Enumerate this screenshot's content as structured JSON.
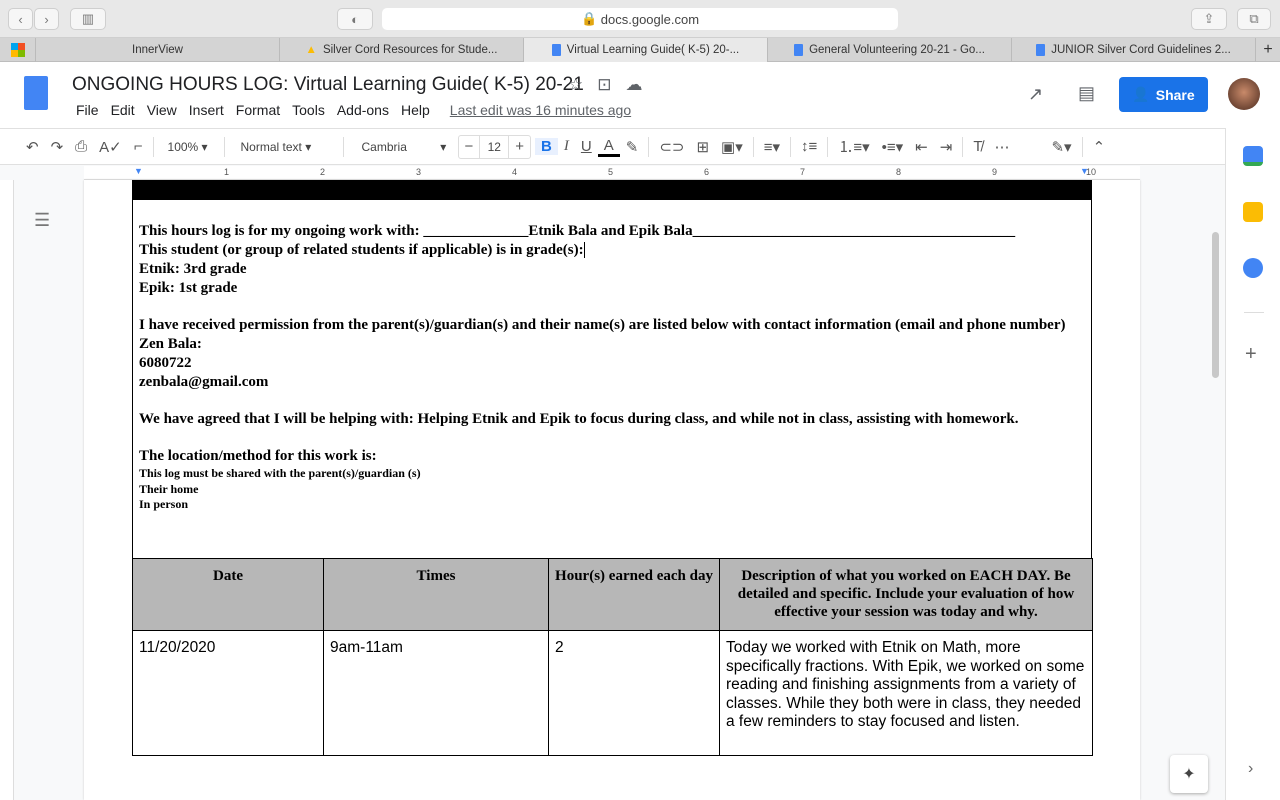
{
  "browser": {
    "url": "docs.google.com",
    "tabs": [
      {
        "label": "InnerView"
      },
      {
        "label": "Silver Cord Resources for Stude..."
      },
      {
        "label": "Virtual Learning Guide( K-5) 20-...",
        "active": true
      },
      {
        "label": "General Volunteering 20-21 - Go..."
      },
      {
        "label": "JUNIOR Silver Cord Guidelines 2..."
      }
    ]
  },
  "doc": {
    "title": "ONGOING HOURS LOG: Virtual Learning Guide( K-5) 20-21",
    "menu": [
      "File",
      "Edit",
      "View",
      "Insert",
      "Format",
      "Tools",
      "Add-ons",
      "Help"
    ],
    "last_edit": "Last edit was 16 minutes ago",
    "share": "Share"
  },
  "toolbar": {
    "zoom": "100%",
    "style": "Normal text",
    "font": "Cambria",
    "size": "12"
  },
  "ruler": [
    "1",
    "2",
    "3",
    "4",
    "5",
    "6",
    "7",
    "8",
    "9",
    "10"
  ],
  "body": {
    "l1": "This hours log is for my ongoing work with: ______________Etnik Bala and Epik Bala___________________________________________",
    "l2": "This student (or group of related students if applicable) is in grade(s):",
    "l3": "Etnik: 3rd grade",
    "l4": "Epik: 1st grade",
    "l5": "I have received permission from the parent(s)/guardian(s) and their name(s) are listed below with contact information (email and phone number)",
    "l6": "Zen Bala:",
    "l7": "6080722",
    "l8": "zenbala@gmail.com",
    "l9": "We have agreed that I will be helping with: Helping Etnik and Epik to focus during class, and while not in class, assisting with homework.",
    "l10": "The location/method for this work is:",
    "l11": "This log must be shared with the parent(s)/guardian (s)",
    "l12": "Their home",
    "l13": "In person"
  },
  "table": {
    "headers": [
      "Date",
      "Times",
      "Hour(s) earned each day",
      "Description of what you worked on EACH DAY. Be detailed and specific. Include your evaluation of how effective your session was today and why."
    ],
    "rows": [
      [
        "11/20/2020",
        "9am-11am",
        "2",
        "Today we worked with Etnik on Math, more specifically fractions. With Epik, we worked on some reading and finishing assignments from a variety of classes. While they both were in class, they needed a few reminders to stay focused and listen."
      ]
    ]
  }
}
